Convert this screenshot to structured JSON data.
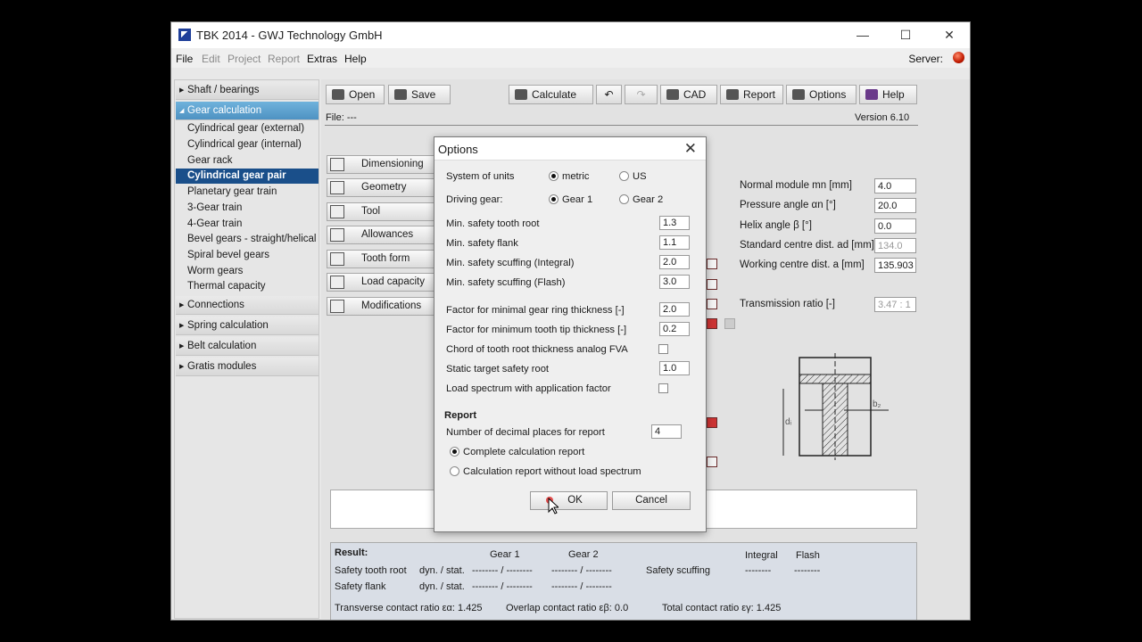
{
  "window": {
    "title": "TBK 2014 - GWJ Technology GmbH",
    "controls": [
      "—",
      "☐",
      "✕"
    ]
  },
  "menu": {
    "items": [
      "File",
      "Edit",
      "Project",
      "Report",
      "Extras",
      "Help"
    ],
    "server_label": "Server:",
    "server_status_color": "#c01a00"
  },
  "sidebar": {
    "sections": [
      "Shaft / bearings",
      "Gear calculation",
      "Connections",
      "Spring calculation",
      "Belt calculation",
      "Gratis modules"
    ],
    "gear_items": [
      "Cylindrical gear (external)",
      "Cylindrical gear (internal)",
      "Gear rack",
      "Cylindrical gear pair",
      "Planetary gear train",
      "3-Gear train",
      "4-Gear train",
      "Bevel gears - straight/helical",
      "Spiral bevel gears",
      "Worm gears",
      "Thermal capacity"
    ],
    "selected": "Cylindrical gear pair"
  },
  "toolbar": {
    "open": "Open",
    "save": "Save",
    "calculate": "Calculate",
    "undo": "↶",
    "redo": "↷",
    "cad": "CAD",
    "report": "Report",
    "options": "Options",
    "help": "Help"
  },
  "file_line": {
    "file": "File: ---",
    "version": "Version 6.10"
  },
  "left_buttons": [
    "Dimensioning",
    "Geometry",
    "Tool",
    "Allowances",
    "Tooth form",
    "Load capacity",
    "Modifications"
  ],
  "right_params": [
    {
      "label": "Normal module mn [mm]",
      "value": "4.0",
      "gray": false
    },
    {
      "label": "Pressure angle αn [°]",
      "value": "20.0",
      "gray": false
    },
    {
      "label": "Helix angle β [°]",
      "value": "0.0",
      "gray": false
    },
    {
      "label": "Standard centre dist. ad [mm]",
      "value": "134.0",
      "gray": true
    },
    {
      "label": "Working centre dist. a [mm]",
      "value": "135.903",
      "gray": false
    },
    {
      "label": "Transmission ratio [-]",
      "value": "3.47 : 1",
      "gray": true
    }
  ],
  "drawing": {
    "label_left": "dᵢ",
    "label_right": "b₂"
  },
  "result": {
    "title": "Result:",
    "col_gear1": "Gear 1",
    "col_gear2": "Gear 2",
    "col_integral": "Integral",
    "col_flash": "Flash",
    "row1_label": "Safety tooth root",
    "row1_type": "dyn. / stat.",
    "row2_label": "Safety flank",
    "row2_type": "dyn. / stat.",
    "dash_pair": "-------- / --------",
    "safety_scuffing": "Safety scuffing",
    "dash": "--------",
    "transverse": "Transverse contact ratio εα: 1.425",
    "overlap": "Overlap contact ratio εβ: 0.0",
    "total": "Total contact ratio εγ: 1.425"
  },
  "dialog": {
    "title": "Options",
    "units_label": "System of units",
    "units_options": [
      "metric",
      "US"
    ],
    "units_selected": "metric",
    "driving_label": "Driving gear:",
    "driving_options": [
      "Gear 1",
      "Gear 2"
    ],
    "driving_selected": "Gear 1",
    "fields": [
      {
        "label": "Min. safety tooth root",
        "value": "1.3"
      },
      {
        "label": "Min. safety flank",
        "value": "1.1"
      },
      {
        "label": "Min. safety scuffing (Integral)",
        "value": "2.0"
      },
      {
        "label": "Min. safety scuffing (Flash)",
        "value": "3.0"
      },
      {
        "label": "Factor for minimal gear ring thickness [-]",
        "value": "2.0"
      },
      {
        "label": "Factor for minimum tooth tip thickness [-]",
        "value": "0.2"
      },
      {
        "label": "Chord of tooth root thickness analog FVA",
        "checkbox": false
      },
      {
        "label": "Static target safety root",
        "value": "1.0"
      },
      {
        "label": "Load spectrum with application factor",
        "checkbox": false
      }
    ],
    "report_heading": "Report",
    "decimal_label": "Number of decimal places for report",
    "decimal_value": "4",
    "report_options": [
      "Complete calculation report",
      "Calculation report without load spectrum"
    ],
    "report_selected": "Complete calculation report",
    "ok": "OK",
    "cancel": "Cancel"
  }
}
